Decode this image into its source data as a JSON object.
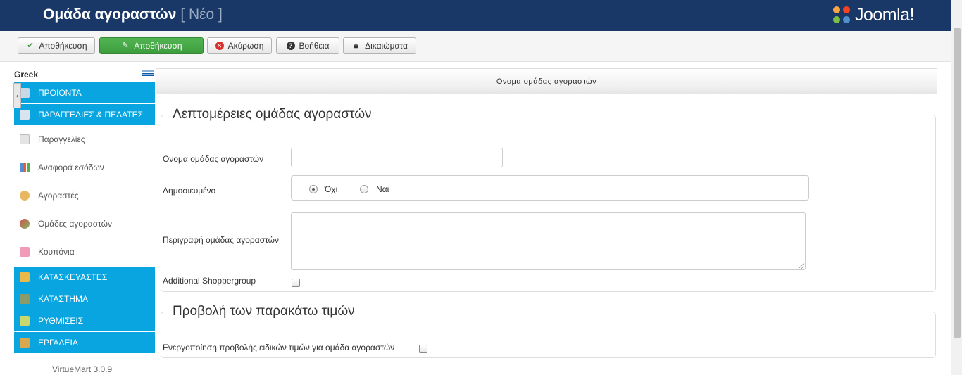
{
  "header": {
    "title": "Ομάδα αγοραστών",
    "subtitle": "[ Νέο ]",
    "logo_text": "Joomla!",
    "logo_icon": "joomla-logo"
  },
  "toolbar": {
    "buttons": [
      {
        "label": "Αποθήκευση",
        "icon": "check-icon"
      },
      {
        "label": "Αποθήκευση",
        "icon": "edit-icon"
      },
      {
        "label": "Ακύρωση",
        "icon": "cancel-icon"
      },
      {
        "label": "Βοήθεια",
        "icon": "help-icon"
      },
      {
        "label": "Δικαιώματα",
        "icon": "lock-icon"
      }
    ]
  },
  "sidebar": {
    "language": "Greek",
    "menu": [
      {
        "label": "ΠΡΟΙΟΝΤΑ",
        "type": "section",
        "icon": "products-icon"
      },
      {
        "label": "ΠΑΡΑΓΓΕΛΙΕΣ & ΠΕΛΑΤΕΣ",
        "type": "section",
        "icon": "orders-icon"
      },
      {
        "label": "Παραγγελίες",
        "type": "item",
        "icon": "orders-list-icon"
      },
      {
        "label": "Αναφορά εσόδων",
        "type": "item",
        "icon": "revenue-report-icon"
      },
      {
        "label": "Αγοραστές",
        "type": "item",
        "icon": "shoppers-icon"
      },
      {
        "label": "Ομάδες αγοραστών",
        "type": "item",
        "icon": "shopper-groups-icon"
      },
      {
        "label": "Κουπόνια",
        "type": "item",
        "icon": "coupons-icon"
      },
      {
        "label": "ΚΑΤΑΣΚΕΥΑΣΤΕΣ",
        "type": "section",
        "icon": "manufacturers-icon"
      },
      {
        "label": "ΚΑΤΑΣΤΗΜΑ",
        "type": "section",
        "icon": "store-icon"
      },
      {
        "label": "ΡΥΘΜΙΣΕΙΣ",
        "type": "section",
        "icon": "settings-icon"
      },
      {
        "label": "ΕΡΓΑΛΕΙΑ",
        "type": "section",
        "icon": "tools-icon"
      }
    ],
    "version": "VirtueMart 3.0.9"
  },
  "main": {
    "tab": "Ονομα ομάδας αγοραστών",
    "details": {
      "legend": "Λεπτομέρειες ομάδας αγοραστών",
      "name_label": "Ονομα ομάδας αγοραστών",
      "name_value": "",
      "published_label": "Δημοσιευμένο",
      "published_options": [
        "Όχι",
        "Ναι"
      ],
      "published_selected": "Όχι",
      "description_label": "Περιγραφή ομάδας αγοραστών",
      "description_value": "",
      "additional_label": "Additional Shoppergroup",
      "additional_checked": false
    },
    "prices": {
      "legend": "Προβολή των παρακάτω τιμών",
      "enable_label": "Ενεργοποίηση προβολής ειδικών τιμών για ομάδα αγοραστών",
      "enable_checked": false
    }
  }
}
